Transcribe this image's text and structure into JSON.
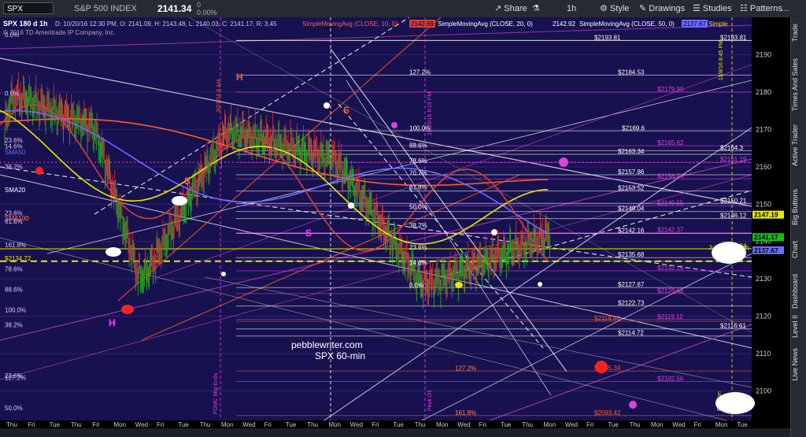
{
  "toolbar": {
    "symbol": "SPX",
    "index_name": "S&P 500 INDEX",
    "price": "2141.34",
    "change": "0",
    "change_pct": "0.00%",
    "share": "Share",
    "timeframe": "1h",
    "style": "Style",
    "drawings": "Drawings",
    "studies": "Studies",
    "patterns": "Patterns"
  },
  "header": {
    "title": "SPX 180 d 1h",
    "ohlc": "D: 10/20/16 12:30 PM,  O: 2141.09,  H: 2143.48,  L: 2140.03,  C: 2141.17,  R: 3.45",
    "sma10_label": "SimpleMovingAvg (CLOSE, 10, 0)",
    "sma10_value": "2142.69",
    "sma20_label": "SimpleMovingAvg (CLOSE, 20, 0)",
    "sma20_value": "2142.92",
    "sma50_label": "SimpleMovingAvg (CLOSE, 50, 0)",
    "sma50_value": "2137.67",
    "sma_trunc": "Simple",
    "copyright": "© 2016 TD Ameritrade IP Company, Inc."
  },
  "side_tabs": [
    "Trade",
    "Times And Sales",
    "Active Trader",
    "Big Buttons",
    "Chart",
    "Dashboard",
    "Level II",
    "Live News"
  ],
  "watermark": {
    "line1": "pebblewriter.com",
    "line2": "SPX 60-min"
  },
  "annotations": {
    "h1": "H",
    "h2": "H",
    "s1": "S",
    "s2": "S",
    "s3": "S",
    "fomc": "FOMC Mtg Ends",
    "date1": "9/21/16 8 AM",
    "date2": "10/20/16 8:15 PM",
    "date3": "11/8/16 8:45 PM",
    "peak_oil": "Peak Oil",
    "election": "Election",
    "sma20": "SMA20",
    "sma50": "SMA50",
    "sma100": "SMA100",
    "july_high": "July 2016 high"
  },
  "chart_data": {
    "type": "line",
    "title": "SPX 180 d 1h",
    "ylim": [
      2090,
      2200
    ],
    "y_ticks": [
      2100,
      2110,
      2120,
      2130,
      2140,
      2150,
      2160,
      2170,
      2180,
      2190
    ],
    "x_ticks": [
      "Thu",
      "Fri",
      "Tue",
      "Thu",
      "Fri",
      "Mon",
      "Wed",
      "Fri",
      "Tue",
      "Thu",
      "Mon",
      "Wed",
      "Fri",
      "Tue",
      "Thu",
      "Mon",
      "Wed",
      "Fri",
      "Tue",
      "Thu",
      "Mon",
      "Wed",
      "Fri",
      "Tue",
      "Thu",
      "Mon",
      "Wed",
      "Fri",
      "Tue",
      "Thu",
      "Mon",
      "Wed",
      "Fri",
      "Mon",
      "Tue"
    ],
    "price_markers": [
      {
        "label": "2147.19",
        "value": 2147.19,
        "color": "#e8e800"
      },
      {
        "label": "2141.17",
        "value": 2141.17,
        "color": "#10c010"
      },
      {
        "label": "2137.67",
        "value": 2137.67,
        "color": "#6b6bff"
      }
    ],
    "left_fib_labels": [
      {
        "label": "0.0%",
        "value": 2194.5
      },
      {
        "label": "0.0%",
        "value": 2178.8
      },
      {
        "label": "14.6%",
        "value": 2164.7
      },
      {
        "label": "23.6%",
        "value": 2166.3
      },
      {
        "label": "38.2%",
        "value": 2159.2
      },
      {
        "label": "23.6%",
        "value": 2146.8
      },
      {
        "label": "61.8%",
        "value": 2144.6
      },
      {
        "label": "161.8%",
        "value": 2138.3
      },
      {
        "label": "78.6%",
        "value": 2131.8
      },
      {
        "label": "88.6%",
        "value": 2126.4
      },
      {
        "label": "100.0%",
        "value": 2120.9
      },
      {
        "label": "38.2%",
        "value": 2116.9
      },
      {
        "label": "23.6%",
        "value": 2103.3
      },
      {
        "label": "127.2%",
        "value": 2102.8
      },
      {
        "label": "50.0%",
        "value": 2094.6
      }
    ],
    "fib_levels": [
      {
        "label": "$2193.81",
        "value": 2193.81,
        "color": "#ffffff"
      },
      {
        "label": "$2193.81",
        "value": 2193.81,
        "color": "#ffffff"
      },
      {
        "label": "$2184.53",
        "value": 2184.53,
        "color": "#ffffff"
      },
      {
        "label": "$2179.99",
        "value": 2179.99,
        "color": "#e040e0"
      },
      {
        "label": "$2169.6",
        "value": 2169.6,
        "color": "#ffffff"
      },
      {
        "label": "$2165.62",
        "value": 2165.62,
        "color": "#e040e0"
      },
      {
        "label": "$2164.3",
        "value": 2164.3,
        "color": "#ffffff"
      },
      {
        "label": "$2163.34",
        "value": 2163.34,
        "color": "#ffffff"
      },
      {
        "label": "$2161.19",
        "value": 2161.19,
        "color": "#e040e0"
      },
      {
        "label": "$2157.86",
        "value": 2157.86,
        "color": "#ffffff"
      },
      {
        "label": "$2156.74",
        "value": 2156.74,
        "color": "#e040e0"
      },
      {
        "label": "$2153.52",
        "value": 2153.52,
        "color": "#ffffff"
      },
      {
        "label": "$2150.21",
        "value": 2150.21,
        "color": "#ffffff"
      },
      {
        "label": "$2149.55",
        "value": 2149.55,
        "color": "#e040e0"
      },
      {
        "label": "$2148.04",
        "value": 2148.04,
        "color": "#ffffff"
      },
      {
        "label": "$2146.12",
        "value": 2146.12,
        "color": "#ffffff"
      },
      {
        "label": "$2142.16",
        "value": 2142.16,
        "color": "#ffffff"
      },
      {
        "label": "$2142.37",
        "value": 2142.37,
        "color": "#e040e0"
      },
      {
        "label": "$2138.04",
        "value": 2138.04,
        "color": "#e8e800"
      },
      {
        "label": "$2135.68",
        "value": 2135.68,
        "color": "#ffffff"
      },
      {
        "label": "$2134.72",
        "value": 2134.72,
        "color": "#e8e800"
      },
      {
        "label": "$2132.15",
        "value": 2132.15,
        "color": "#e040e0"
      },
      {
        "label": "$2127.67",
        "value": 2127.67,
        "color": "#ffffff"
      },
      {
        "label": "$2126.06",
        "value": 2126.06,
        "color": "#e040e0"
      },
      {
        "label": "$2122.73",
        "value": 2122.73,
        "color": "#ffffff"
      },
      {
        "label": "$2119.12",
        "value": 2119.12,
        "color": "#e040e0"
      },
      {
        "label": "$2118.65",
        "value": 2118.65,
        "color": "#ff5a2a"
      },
      {
        "label": "$2116.61",
        "value": 2116.61,
        "color": "#ffffff"
      },
      {
        "label": "$2114.72",
        "value": 2114.72,
        "color": "#ffffff"
      },
      {
        "label": "$2105.34",
        "value": 2105.34,
        "color": "#ff5a2a"
      },
      {
        "label": "$2102.56",
        "value": 2102.56,
        "color": "#e040e0"
      },
      {
        "label": "$2093.42",
        "value": 2093.42,
        "color": "#ff5a2a"
      }
    ],
    "mid_fib_labels": [
      {
        "label": "127.2%",
        "value": 2184.5
      },
      {
        "label": "100.0%",
        "value": 2169.6
      },
      {
        "label": "88.6%",
        "value": 2164.9
      },
      {
        "label": "78.6%",
        "value": 2160.8
      },
      {
        "label": "70.7%",
        "value": 2157.5
      },
      {
        "label": "61.8%",
        "value": 2153.7
      },
      {
        "label": "50.0%",
        "value": 2148.5
      },
      {
        "label": "38.2%",
        "value": 2143.5
      },
      {
        "label": "23.6%",
        "value": 2137.6
      },
      {
        "label": "14.6%",
        "value": 2133.5
      },
      {
        "label": "0.0%",
        "value": 2127.5
      },
      {
        "label": "127.2%",
        "value": 2105.3
      },
      {
        "label": "161.8%",
        "value": 2093.4
      }
    ],
    "series": [
      {
        "name": "SMA10",
        "color": "#d04040"
      },
      {
        "name": "SMA20",
        "color": "#e8e800"
      },
      {
        "name": "SMA50",
        "color": "#6b6bff"
      },
      {
        "name": "SMA100",
        "color": "#ff5a2a"
      }
    ]
  }
}
